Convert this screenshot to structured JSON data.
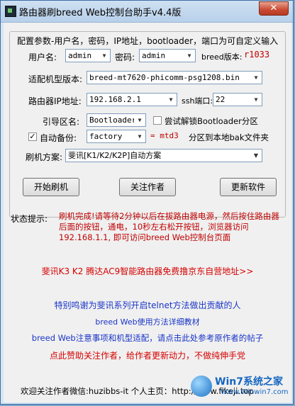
{
  "window": {
    "title": "路由器刷breed Web控制台助手v4.4版",
    "close_label": "✕"
  },
  "config": {
    "legend": "配置参数-用户名，密码，IP地址，bootloader，端口为可自定义输入",
    "username_label": "用户名:",
    "username_value": "admin",
    "password_label": "密码:",
    "password_value": "admin",
    "breed_version_label": "breed版本:",
    "breed_version_value": "r1033",
    "model_label": "适配机型版本:",
    "model_value": "breed-mt7620-phicomm-psg1208.bin",
    "ip_label": "路由器IP地址:",
    "ip_value": "192.168.2.1",
    "ssh_label": "ssh端口:",
    "ssh_value": "22",
    "boot_label": "引导区名:",
    "boot_value": "Bootloader",
    "unlock_label": "尝试解锁Bootloader分区",
    "unlock_checked": false,
    "backup_label": "自动备份:",
    "backup_checked": true,
    "backup_value": "factory",
    "backup_mtd": "= mtd3",
    "backup_suffix": "分区到本地bak文件夹",
    "plan_label": "刷机方案:",
    "plan_value": "斐讯[K1/K2/K2P]自动方案"
  },
  "buttons": {
    "start": "开始刷机",
    "follow": "关注作者",
    "update": "更新软件"
  },
  "status": {
    "label": "状态提示:",
    "text": "刷机完成!请等待2分钟以后在拔路由器电源，然后按住路由器后面的按钮，通电，10秒左右松开按钮，浏览器访问 192.168.1.1, 即可访问breed Web控制台页面"
  },
  "links": {
    "promo": "斐讯K3  K2  腾达AC9智能路由器免费撸京东自营地址>>",
    "thanks": "特别鸣谢为斐讯系列开启telnet方法做出贡献的人",
    "tutorial": "breed Web使用方法详细教材",
    "notes": "breed Web注意事项和机型适配，请点击此处参考原作者的帖子",
    "donate": "点此赞助关注作者，给作者更新动力，不做纯伸手党"
  },
  "footer": {
    "text": "欢迎关注作者微信:huzibbs-it 个人主页：http://www.fikeji.top"
  },
  "watermark": {
    "brand": "Win7系统之家",
    "url": "Www.Winwin7.com"
  }
}
